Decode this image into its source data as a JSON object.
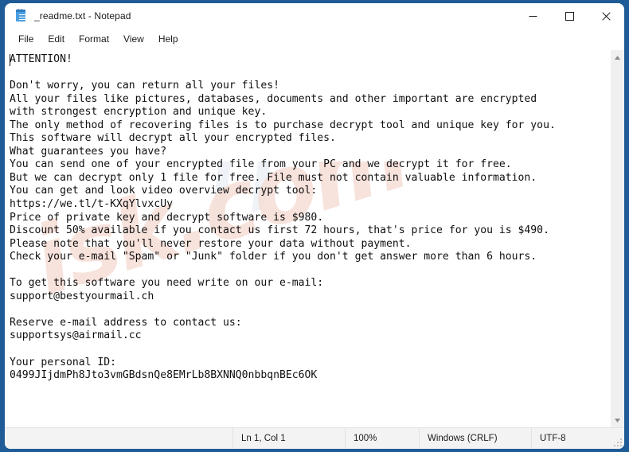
{
  "window": {
    "title": "_readme.txt - Notepad",
    "icon": "notepad-icon",
    "controls": {
      "minimize": "–",
      "maximize": "□",
      "close": "✕"
    }
  },
  "menu": {
    "items": [
      {
        "label": "File"
      },
      {
        "label": "Edit"
      },
      {
        "label": "Format"
      },
      {
        "label": "View"
      },
      {
        "label": "Help"
      }
    ]
  },
  "watermark": {
    "text": "isk.com",
    "accent_color": "#f6ded6"
  },
  "document": {
    "filename": "_readme.txt",
    "body": "ATTENTION!\n\nDon't worry, you can return all your files!\nAll your files like pictures, databases, documents and other important are encrypted\nwith strongest encryption and unique key.\nThe only method of recovering files is to purchase decrypt tool and unique key for you.\nThis software will decrypt all your encrypted files.\nWhat guarantees you have?\nYou can send one of your encrypted file from your PC and we decrypt it for free.\nBut we can decrypt only 1 file for free. File must not contain valuable information.\nYou can get and look video overview decrypt tool:\nhttps://we.tl/t-KXqYlvxcUy\nPrice of private key and decrypt software is $980.\nDiscount 50% available if you contact us first 72 hours, that's price for you is $490.\nPlease note that you'll never restore your data without payment.\nCheck your e-mail \"Spam\" or \"Junk\" folder if you don't get answer more than 6 hours.\n\nTo get this software you need write on our e-mail:\nsupport@bestyourmail.ch\n\nReserve e-mail address to contact us:\nsupportsys@airmail.cc\n\nYour personal ID:\n0499JIjdmPh8Jto3vmGBdsnQe8EMrLb8BXNNQ0nbbqnBEc6OK",
    "details": {
      "video_url": "https://we.tl/t-KXqYlvxcUy",
      "price": "$980",
      "discount_price": "$490",
      "discount_percent": "50%",
      "discount_window": "72 hours",
      "response_time": "6 hours",
      "primary_email": "support@bestyourmail.ch",
      "reserve_email": "supportsys@airmail.cc",
      "personal_id": "0499JIjdmPh8Jto3vmGBdsnQe8EMrLb8BXNNQ0nbbqnBEc6OK"
    }
  },
  "scrollbar": {
    "up_arrow": "▲",
    "down_arrow": "▼"
  },
  "status_bar": {
    "cursor_position": "Ln 1, Col 1",
    "zoom": "100%",
    "line_ending": "Windows (CRLF)",
    "encoding": "UTF-8"
  }
}
